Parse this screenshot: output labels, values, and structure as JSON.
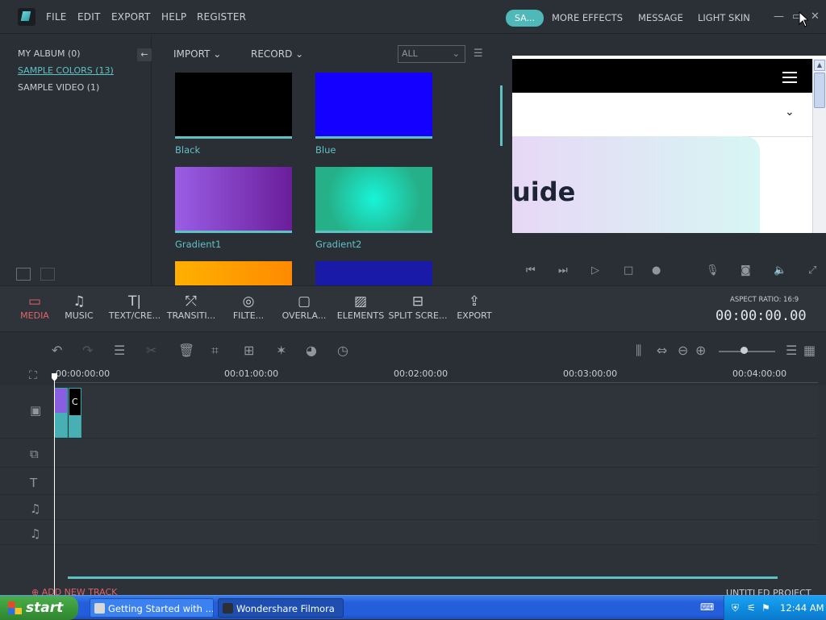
{
  "menu": [
    "FILE",
    "EDIT",
    "EXPORT",
    "HELP",
    "REGISTER"
  ],
  "header_right": {
    "save_label": "SA...",
    "more_effects": "MORE EFFECTS",
    "message": "MESSAGE",
    "light_skin": "LIGHT SKIN"
  },
  "library": {
    "items": [
      "MY ALBUM (0)",
      "SAMPLE COLORS (13)",
      "SAMPLE VIDEO (1)"
    ],
    "active_index": 1
  },
  "media_toolbar": {
    "import": "IMPORT",
    "record": "RECORD",
    "filter": "ALL"
  },
  "media_items": [
    {
      "label": "Black",
      "color": "#000000"
    },
    {
      "label": "Blue",
      "color": "#1400ff"
    },
    {
      "label": "Gradient1",
      "color": "#8a46d6"
    },
    {
      "label": "Gradient2",
      "color": "#25c9a0"
    },
    {
      "label": "",
      "color": "#ff9d00"
    },
    {
      "label": "",
      "color": "#1a1aa8"
    }
  ],
  "preview": {
    "heading": "uide"
  },
  "tools": [
    {
      "label": "MEDIA",
      "icon": "folder-icon",
      "active": true
    },
    {
      "label": "MUSIC",
      "icon": "music-icon",
      "active": false
    },
    {
      "label": "TEXT/CRE...",
      "icon": "text-icon",
      "active": false
    },
    {
      "label": "TRANSITI...",
      "icon": "transition-icon",
      "active": false
    },
    {
      "label": "FILTE...",
      "icon": "filter-icon",
      "active": false
    },
    {
      "label": "OVERLA...",
      "icon": "overlay-icon",
      "active": false
    },
    {
      "label": "ELEMENTS",
      "icon": "image-icon",
      "active": false
    },
    {
      "label": "SPLIT SCRE...",
      "icon": "split-screen-icon",
      "active": false
    },
    {
      "label": "EXPORT",
      "icon": "export-icon",
      "active": false
    }
  ],
  "aspect_ratio": "ASPECT RATIO: 16:9",
  "timecode": "00:00:00.00",
  "ruler": [
    "00:00:00:00",
    "00:01:00:00",
    "00:02:00:00",
    "00:03:00:00",
    "00:04:00:00"
  ],
  "clip_label": "C",
  "add_track": "ADD NEW TRACK",
  "project_name": "UNTITLED PROJECT",
  "taskbar": {
    "start": "start",
    "tasks": [
      "Getting Started with ...",
      "Wondershare Filmora"
    ],
    "clock": "12:44 AM"
  },
  "colors": {
    "accent": "#5ec2c4",
    "active_tool": "#e0636a"
  }
}
